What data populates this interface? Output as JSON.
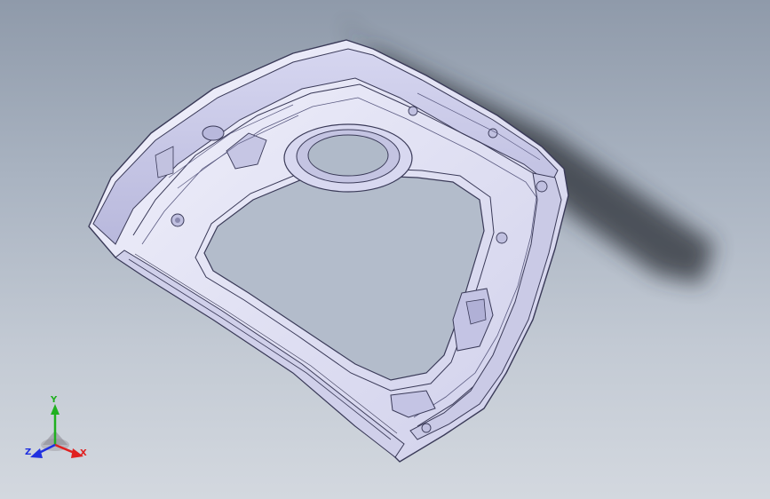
{
  "viewport": {
    "background_top": "#8f9aaa",
    "background_bottom": "#d3d8df"
  },
  "model": {
    "part_color": "#e4e4f6",
    "shade_color": "#c8c8e6",
    "edge_color": "#3a3a58",
    "shadow_color": "#2a2e36"
  },
  "triad": {
    "x_label": "X",
    "y_label": "Y",
    "z_label": "Z",
    "x_color": "#e02020",
    "y_color": "#20b020",
    "z_color": "#2030e0"
  }
}
